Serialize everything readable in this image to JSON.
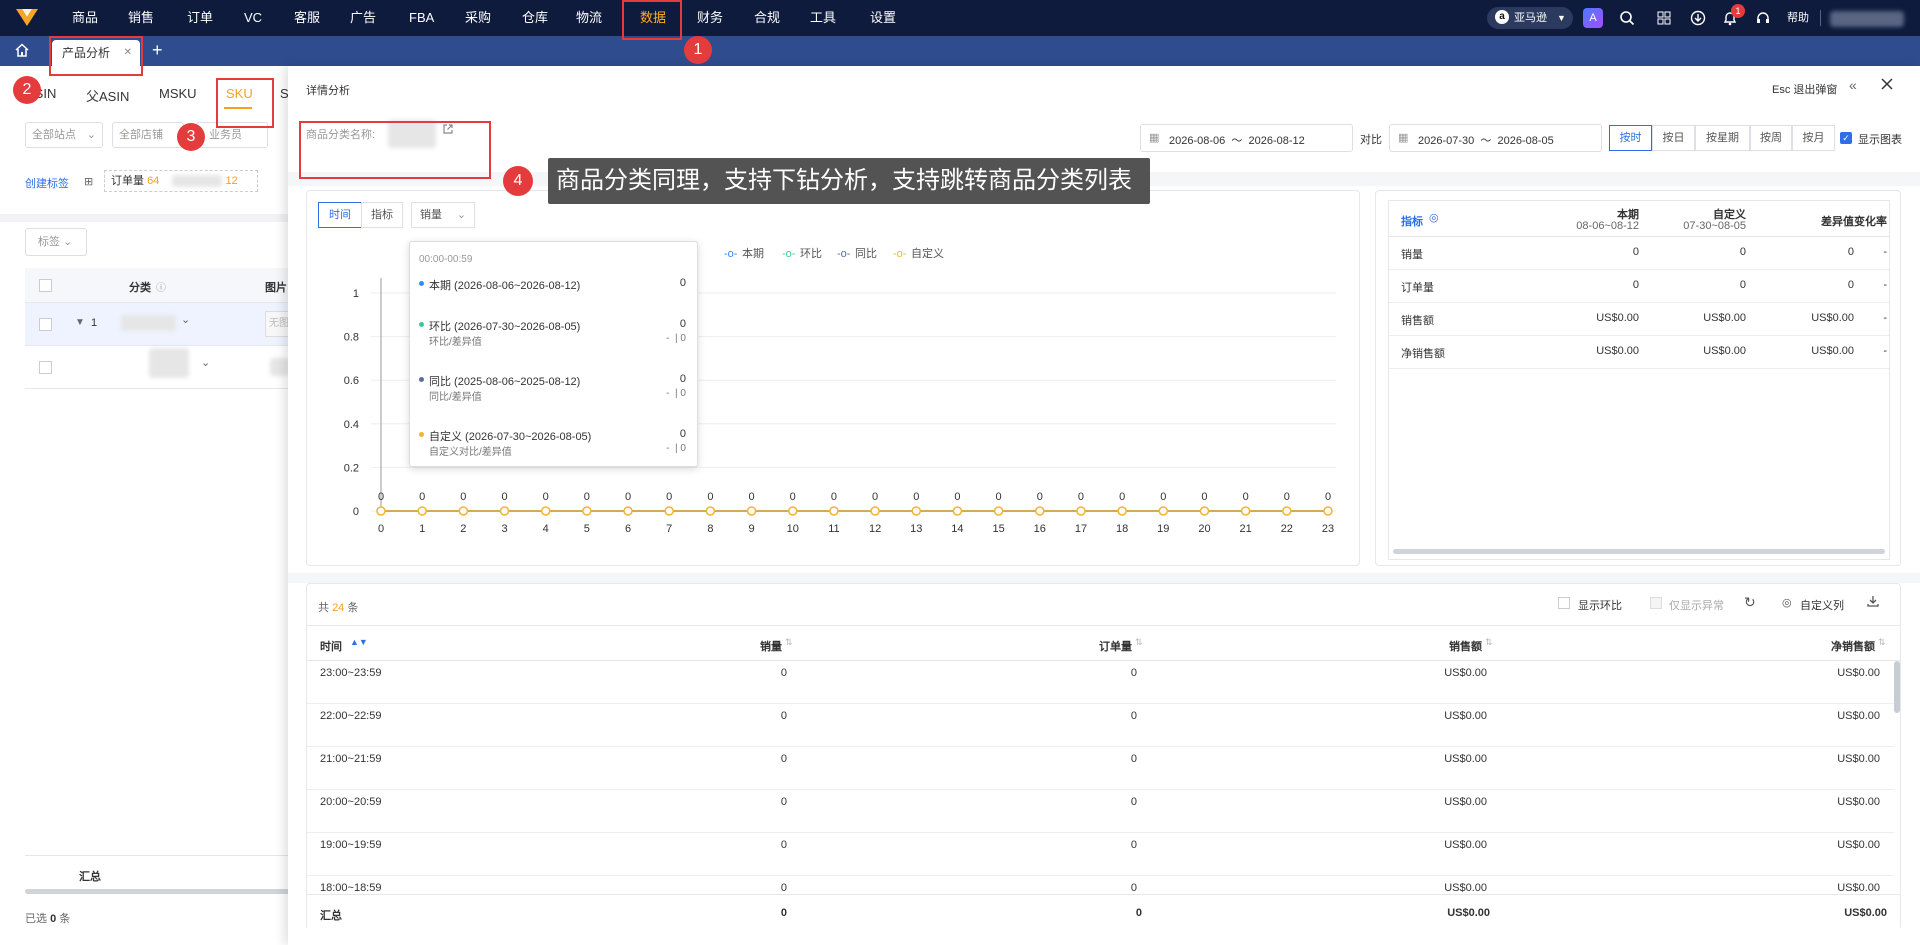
{
  "nav": {
    "items": [
      "商品",
      "销售",
      "订单",
      "VC",
      "客服",
      "广告",
      "FBA",
      "采购",
      "仓库",
      "物流",
      "数据",
      "财务",
      "合规",
      "工具",
      "设置"
    ],
    "active_index": 10,
    "marketplace": "亚马逊",
    "help": "帮助",
    "notif_count": "1"
  },
  "tabs": {
    "active": "产品分析",
    "close": "✕",
    "add": "+"
  },
  "left": {
    "subtabs": [
      "ASIN",
      "父ASIN",
      "MSKU",
      "SKU",
      "S"
    ],
    "active_subtab": 3,
    "filter_site": "全部站点",
    "filter_shop": "全部店铺",
    "filter_staff": "业务员",
    "create_tag": "创建标签",
    "order_label": "订单量",
    "order_value": "64",
    "order_tail": "12",
    "tag_btn": "标签",
    "col_category": "分类",
    "col_image": "图片",
    "row1_num": "1",
    "no_image": "无图",
    "summary": "汇总",
    "selected_prefix": "已选",
    "selected_count": "0",
    "selected_suffix": "条"
  },
  "drawer": {
    "title": "详情分析",
    "esc": "Esc 退出弹窗",
    "category_label": "商品分类名称:",
    "date_range_1": "2026-08-06  ～  2026-08-12",
    "compare_label": "对比",
    "date_range_2": "2026-07-30  ～  2026-08-05",
    "granularity": [
      "按时",
      "按日",
      "按星期",
      "按周",
      "按月"
    ],
    "granularity_active": 0,
    "show_chart": "显示图表",
    "toggle": [
      "时间",
      "指标"
    ],
    "metric_select": "销量",
    "legend": [
      "本期",
      "环比",
      "同比",
      "自定义"
    ]
  },
  "callout": {
    "number": "4",
    "text": "商品分类同理，支持下钻分析，支持跳转商品分类列表"
  },
  "badges": [
    "1",
    "2",
    "3"
  ],
  "tooltip": {
    "time": "00:00-00:59",
    "rows": [
      {
        "label": "本期 (2026-08-06~2026-08-12)",
        "value": "0",
        "sub": "",
        "sub_value": "",
        "color": "#2f8ff0"
      },
      {
        "label": "环比 (2026-07-30~2026-08-05)",
        "value": "0",
        "sub": "环比/差异值",
        "sub_value": "-  | 0",
        "color": "#3cc9a0"
      },
      {
        "label": "同比 (2025-08-06~2025-08-12)",
        "value": "0",
        "sub": "同比/差异值",
        "sub_value": "-  | 0",
        "color": "#5b6e9a"
      },
      {
        "label": "自定义 (2026-07-30~2026-08-05)",
        "value": "0",
        "sub": "自定义对比/差异值",
        "sub_value": "-  | 0",
        "color": "#f5b334"
      }
    ]
  },
  "chart_data": {
    "type": "line",
    "categories": [
      "0",
      "1",
      "2",
      "3",
      "4",
      "5",
      "6",
      "7",
      "8",
      "9",
      "10",
      "11",
      "12",
      "13",
      "14",
      "15",
      "16",
      "17",
      "18",
      "19",
      "20",
      "21",
      "22",
      "23"
    ],
    "series": [
      {
        "name": "本期",
        "values": [
          0,
          0,
          0,
          0,
          0,
          0,
          0,
          0,
          0,
          0,
          0,
          0,
          0,
          0,
          0,
          0,
          0,
          0,
          0,
          0,
          0,
          0,
          0,
          0
        ]
      },
      {
        "name": "环比",
        "values": [
          0,
          0,
          0,
          0,
          0,
          0,
          0,
          0,
          0,
          0,
          0,
          0,
          0,
          0,
          0,
          0,
          0,
          0,
          0,
          0,
          0,
          0,
          0,
          0
        ]
      },
      {
        "name": "同比",
        "values": [
          0,
          0,
          0,
          0,
          0,
          0,
          0,
          0,
          0,
          0,
          0,
          0,
          0,
          0,
          0,
          0,
          0,
          0,
          0,
          0,
          0,
          0,
          0,
          0
        ]
      },
      {
        "name": "自定义",
        "values": [
          0,
          0,
          0,
          0,
          0,
          0,
          0,
          0,
          0,
          0,
          0,
          0,
          0,
          0,
          0,
          0,
          0,
          0,
          0,
          0,
          0,
          0,
          0,
          0
        ]
      }
    ],
    "yticks": [
      "0",
      "0.2",
      "0.4",
      "0.6",
      "0.8",
      "1"
    ],
    "ylim": [
      0,
      1
    ],
    "grid": true,
    "legend": "top-right"
  },
  "metrics": {
    "header": [
      "指标",
      "本期",
      "自定义",
      "差异值",
      "变化率"
    ],
    "sub_current": "08-06~08-12",
    "sub_custom": "07-30~08-05",
    "rows": [
      [
        "销量",
        "0",
        "0",
        "0",
        "-"
      ],
      [
        "订单量",
        "0",
        "0",
        "0",
        "-"
      ],
      [
        "销售额",
        "US$0.00",
        "US$0.00",
        "US$0.00",
        "-"
      ],
      [
        "净销售额",
        "US$0.00",
        "US$0.00",
        "US$0.00",
        "-"
      ]
    ]
  },
  "table": {
    "total_prefix": "共",
    "total_count": "24",
    "total_suffix": "条",
    "show_mom": "显示环比",
    "only_abnormal": "仅显示异常",
    "custom_cols": "自定义列",
    "columns": [
      "时间",
      "销量",
      "订单量",
      "销售额",
      "净销售额"
    ],
    "rows": [
      [
        "23:00~23:59",
        "0",
        "0",
        "US$0.00",
        "US$0.00"
      ],
      [
        "22:00~22:59",
        "0",
        "0",
        "US$0.00",
        "US$0.00"
      ],
      [
        "21:00~21:59",
        "0",
        "0",
        "US$0.00",
        "US$0.00"
      ],
      [
        "20:00~20:59",
        "0",
        "0",
        "US$0.00",
        "US$0.00"
      ],
      [
        "19:00~19:59",
        "0",
        "0",
        "US$0.00",
        "US$0.00"
      ],
      [
        "18:00~18:59",
        "0",
        "0",
        "US$0.00",
        "US$0.00"
      ]
    ],
    "summary": [
      "汇总",
      "0",
      "0",
      "US$0.00",
      "US$0.00"
    ]
  }
}
